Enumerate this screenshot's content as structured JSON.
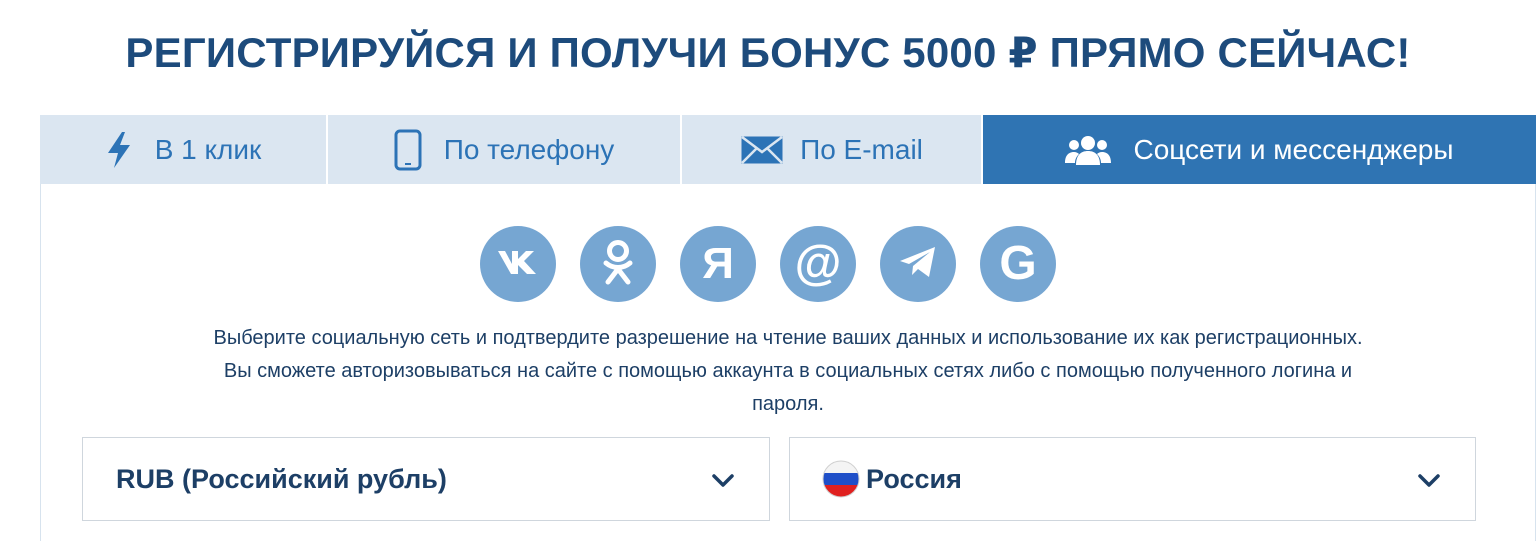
{
  "headline": "РЕГИСТРИРУЙСЯ И ПОЛУЧИ БОНУС 5000 ₽ ПРЯМО СЕЙЧАС!",
  "tabs": [
    {
      "label": "В 1 клик",
      "icon": "lightning-icon"
    },
    {
      "label": "По телефону",
      "icon": "phone-icon"
    },
    {
      "label": "По E-mail",
      "icon": "envelope-icon"
    },
    {
      "label": "Соцсети и мессенджеры",
      "icon": "users-icon",
      "active": true
    }
  ],
  "social_buttons": [
    {
      "name": "vk",
      "icon": "vk-icon"
    },
    {
      "name": "odnoklassniki",
      "icon": "odnoklassniki-icon"
    },
    {
      "name": "yandex",
      "icon": "yandex-icon"
    },
    {
      "name": "mail-ru",
      "icon": "at-icon"
    },
    {
      "name": "telegram",
      "icon": "telegram-icon"
    },
    {
      "name": "google",
      "icon": "google-icon"
    }
  ],
  "info_text": {
    "line1": "Выберите социальную сеть и подтвердите разрешение на чтение ваших данных и использование их как регистрационных.",
    "line2": "Вы сможете авторизовываться на сайте с помощью аккаунта в социальных сетях либо с помощью полученного логина и",
    "line3": "пароля."
  },
  "currency_select": {
    "value": "RUB (Российский рубль)",
    "icon": "chevron-down-icon"
  },
  "country_select": {
    "value": "Россия",
    "icon": "chevron-down-icon",
    "flag": "russia-flag-icon"
  },
  "colors": {
    "headline": "#1d4b7c",
    "tab_bg": "#dbe6f1",
    "tab_text": "#2c73b6",
    "tab_active_bg": "#2f74b3",
    "social_bg": "#76a6d2",
    "body_text": "#1d3f66"
  }
}
